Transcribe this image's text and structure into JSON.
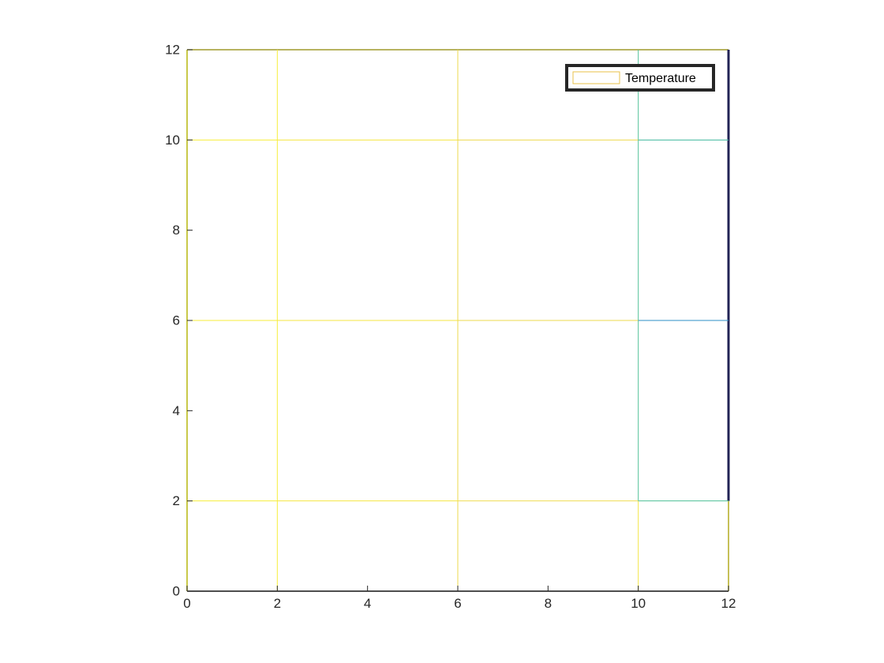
{
  "chart_data": {
    "type": "heatmap",
    "title": "",
    "xlabel": "",
    "ylabel": "",
    "xlim": [
      0,
      12
    ],
    "ylim": [
      0,
      12
    ],
    "xticks": [
      0,
      2,
      4,
      6,
      8,
      10,
      12
    ],
    "yticks": [
      0,
      2,
      4,
      6,
      8,
      10,
      12
    ],
    "x_tick_labels": [
      "0",
      "2",
      "4",
      "6",
      "8",
      "10",
      "12"
    ],
    "y_tick_labels": [
      "0",
      "2",
      "4",
      "6",
      "8",
      "10",
      "12"
    ],
    "grid": false,
    "x_nodes": [
      0,
      2,
      6,
      10,
      12
    ],
    "y_nodes": [
      0,
      2,
      6,
      10,
      12
    ],
    "series": [
      {
        "name": "Temperature",
        "style": "edge-only patch mesh",
        "edges": [
          {
            "x": [
              0,
              12
            ],
            "y": [
              0,
              0
            ],
            "color": "#262626"
          },
          {
            "x": [
              0,
              12
            ],
            "y": [
              12,
              12
            ],
            "color": "#9f9a2a"
          },
          {
            "x": [
              0,
              0
            ],
            "y": [
              0,
              12
            ],
            "color": "#bfbf28"
          },
          {
            "x": [
              2,
              2
            ],
            "y": [
              0,
              12
            ],
            "color": "#f7ee3a"
          },
          {
            "x": [
              6,
              6
            ],
            "y": [
              0,
              12
            ],
            "color": "#eed84e"
          },
          {
            "x": [
              10,
              10
            ],
            "y": [
              0,
              2
            ],
            "color": "#f4e64a"
          },
          {
            "x": [
              10,
              10
            ],
            "y": [
              2,
              12
            ],
            "color": "#55c29a"
          },
          {
            "x": [
              12,
              12
            ],
            "y": [
              0,
              2
            ],
            "color": "#b8b12e"
          },
          {
            "x": [
              12,
              12
            ],
            "y": [
              2,
              12
            ],
            "color": "#222355"
          },
          {
            "x": [
              0,
              2
            ],
            "y": [
              2,
              2
            ],
            "color": "#f7ee3a"
          },
          {
            "x": [
              2,
              6
            ],
            "y": [
              2,
              2
            ],
            "color": "#f4e640"
          },
          {
            "x": [
              6,
              10
            ],
            "y": [
              2,
              2
            ],
            "color": "#f0dc52"
          },
          {
            "x": [
              10,
              12
            ],
            "y": [
              2,
              2
            ],
            "color": "#4dbf95"
          },
          {
            "x": [
              0,
              2
            ],
            "y": [
              6,
              6
            ],
            "color": "#f7ee3a"
          },
          {
            "x": [
              2,
              6
            ],
            "y": [
              6,
              6
            ],
            "color": "#f4e640"
          },
          {
            "x": [
              6,
              10
            ],
            "y": [
              6,
              6
            ],
            "color": "#eed84e"
          },
          {
            "x": [
              10,
              12
            ],
            "y": [
              6,
              6
            ],
            "color": "#2b8fc7"
          },
          {
            "x": [
              0,
              2
            ],
            "y": [
              10,
              10
            ],
            "color": "#f7ee3a"
          },
          {
            "x": [
              2,
              6
            ],
            "y": [
              10,
              10
            ],
            "color": "#f4e640"
          },
          {
            "x": [
              6,
              10
            ],
            "y": [
              10,
              10
            ],
            "color": "#eed84e"
          },
          {
            "x": [
              10,
              12
            ],
            "y": [
              10,
              10
            ],
            "color": "#41b89e"
          }
        ]
      }
    ],
    "legend": {
      "location": "top-right",
      "entries": [
        "Temperature"
      ],
      "swatch_color": "#e8c24a"
    }
  }
}
